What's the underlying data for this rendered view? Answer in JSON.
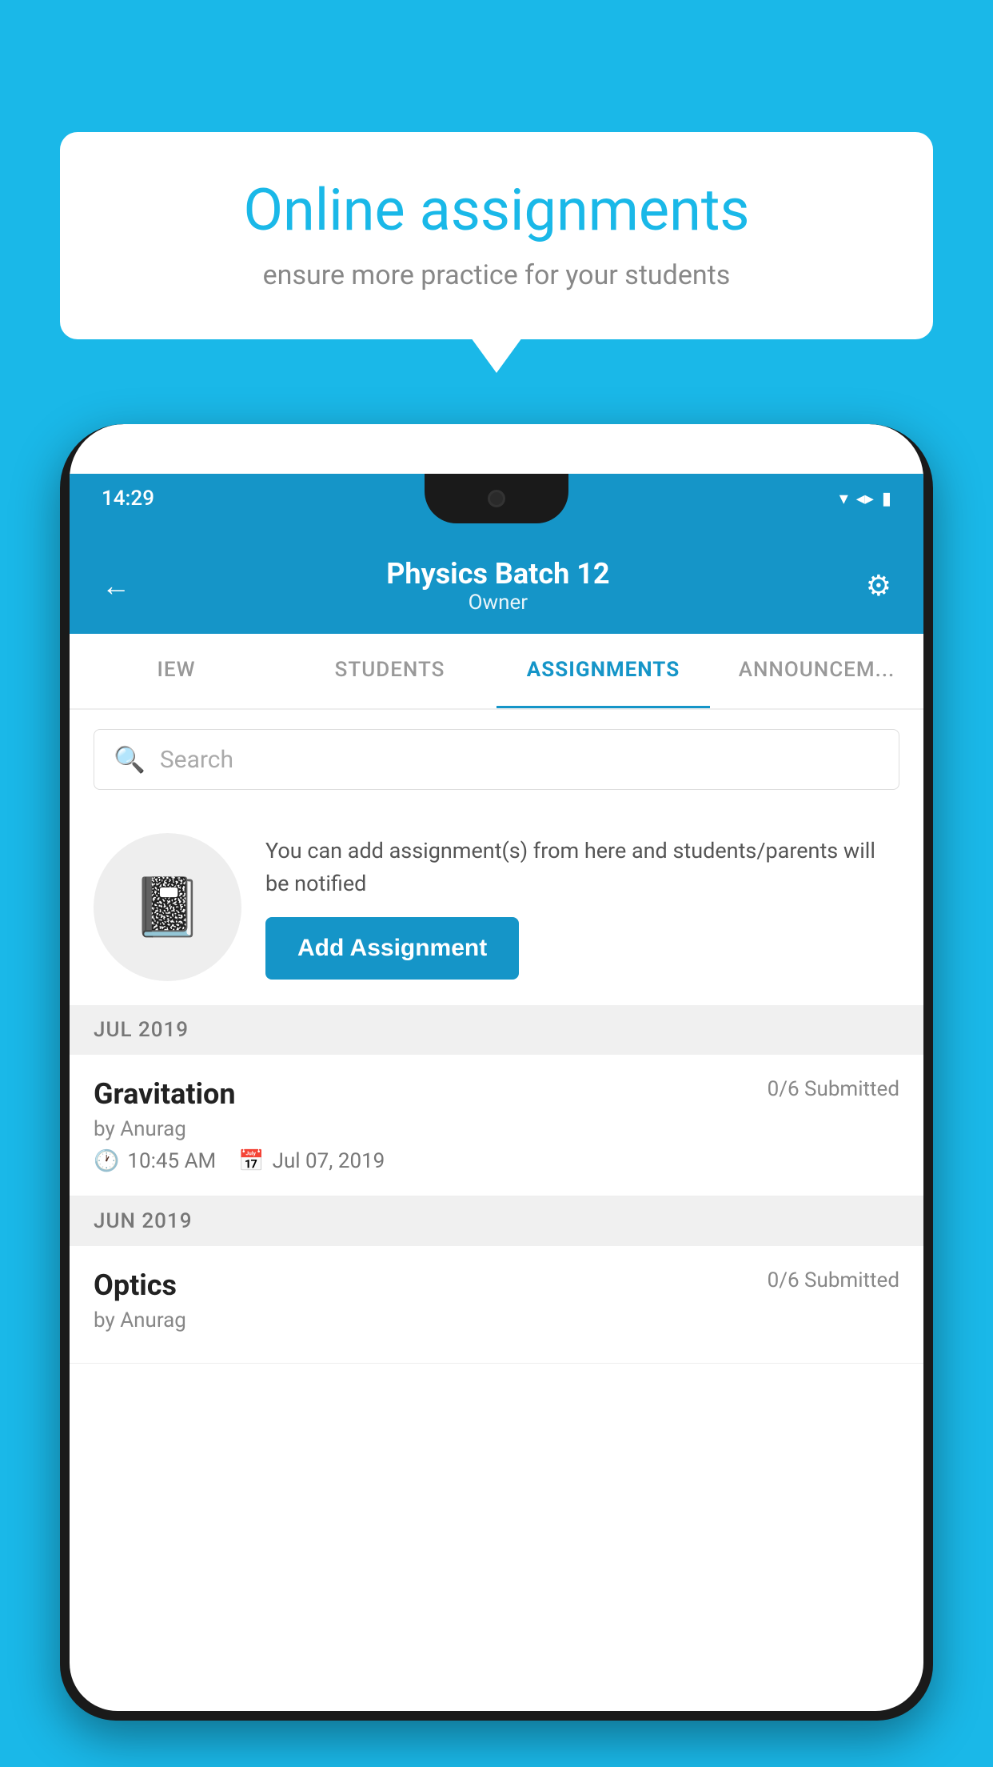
{
  "background_color": "#1ab8e8",
  "speech_bubble": {
    "title": "Online assignments",
    "subtitle": "ensure more practice for your students"
  },
  "phone": {
    "status_bar": {
      "time": "14:29",
      "icons": [
        "wifi",
        "signal",
        "battery"
      ]
    },
    "header": {
      "title": "Physics Batch 12",
      "subtitle": "Owner",
      "back_label": "←",
      "settings_label": "⚙"
    },
    "tabs": [
      {
        "label": "IEW",
        "active": false
      },
      {
        "label": "STUDENTS",
        "active": false
      },
      {
        "label": "ASSIGNMENTS",
        "active": true
      },
      {
        "label": "ANNOUNCEM...",
        "active": false
      }
    ],
    "search": {
      "placeholder": "Search"
    },
    "add_section": {
      "description": "You can add assignment(s) from here and students/parents will be notified",
      "button_label": "Add Assignment"
    },
    "assignment_groups": [
      {
        "month_label": "JUL 2019",
        "assignments": [
          {
            "name": "Gravitation",
            "submitted": "0/6 Submitted",
            "author": "by Anurag",
            "time": "10:45 AM",
            "date": "Jul 07, 2019"
          }
        ]
      },
      {
        "month_label": "JUN 2019",
        "assignments": [
          {
            "name": "Optics",
            "submitted": "0/6 Submitted",
            "author": "by Anurag",
            "time": "",
            "date": ""
          }
        ]
      }
    ]
  }
}
